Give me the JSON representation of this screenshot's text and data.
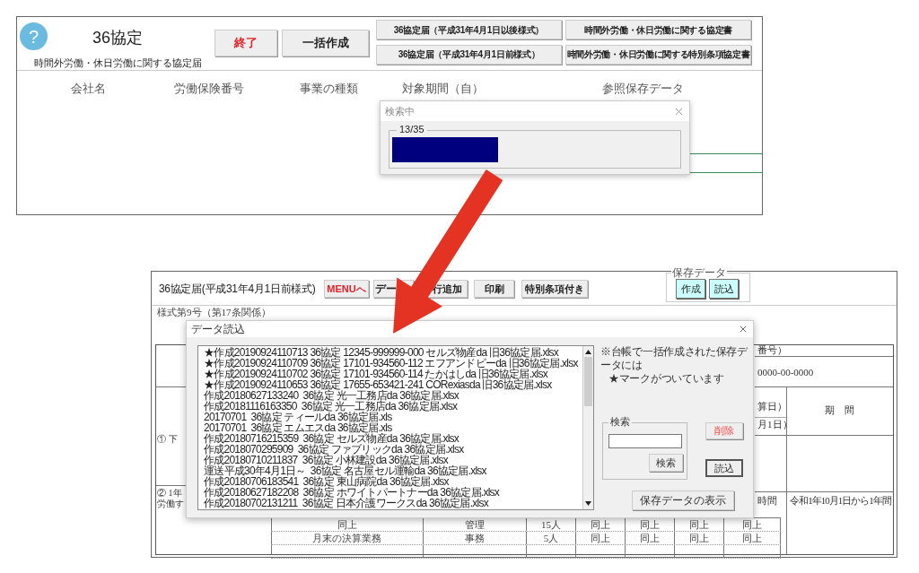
{
  "top_screen": {
    "help_badge": "?",
    "title": "36協定",
    "subtitle": "時間外労働・休日労働に関する協定届",
    "buttons": [
      {
        "label": "終了",
        "kind": "danger"
      },
      {
        "label": "一括作成",
        "kind": "normal"
      }
    ],
    "form_buttons": [
      "36協定届（平成31年4月1日以後様式）",
      "時間外労働・休日労働に関する協定書",
      "36協定届（平成31年4月1日前様式）",
      "時間外労働・休日労働に関する特別条項協定書"
    ],
    "columns": [
      "会社名",
      "労働保険番号",
      "事業の種類",
      "対象期間（自）",
      "参照保存データ"
    ],
    "progress_dialog": {
      "title": "検索中",
      "count": "13/35",
      "level": 0.37
    }
  },
  "bottom_screen": {
    "title": "36協定届(平成31年4月1日前様式)",
    "toolbar": [
      {
        "label": "MENUへ",
        "kind": "danger"
      },
      {
        "label": "デー",
        "kind": "normal"
      },
      {
        "label": "行追加",
        "kind": "normal"
      },
      {
        "label": "印刷",
        "kind": "normal"
      },
      {
        "label": "特別条項付き",
        "kind": "normal"
      }
    ],
    "saved_data": {
      "label": "保存データ",
      "buttons": [
        "作成",
        "読込"
      ]
    },
    "form": {
      "form_number": "様式第9号（第17条関係）",
      "number_header": "番号）",
      "insurance_number": "0000-00-0000",
      "date_labels": [
        "算日）",
        "月1日）"
      ],
      "period_header": "期　間",
      "section_1": "① 下",
      "section_2": [
        "② 1年",
        "労働す"
      ],
      "hours_header": "時間",
      "period": "令和1年10月1日から1年間",
      "rows": [
        [
          "同上",
          "管理",
          "15人",
          "同上",
          "同上",
          "同上",
          "同上"
        ],
        [
          "月末の決算業務",
          "事務",
          "5人",
          "同上",
          "同上",
          "同上",
          "同上"
        ]
      ]
    },
    "dialog": {
      "title": "データ読込",
      "files": [
        "★作成20190924110713 36協定 12345-999999-000 セルズ物産da 旧36協定届.xlsx",
        "★作成20190924110709 36協定 17101-934560-112 エフアンドビーda 旧36協定届.xlsx",
        "★作成20190924110702 36協定 17101-934560-114 たかはしda 旧36協定届.xlsx",
        "★作成20190924110653 36協定 17655-653421-241 CORexiasda 旧36協定届.xlsx",
        "作成20180627133240  36協定 光一工務店da 36協定届.xlsx",
        "作成20181116163350  36協定 光一工務店da 36協定届.xlsx",
        "20170701  36協定 ティールda 36協定届.xls",
        "20170701  36協定 エムエスda 36協定届.xls",
        "作成20180716215359  36協定 セルズ物産da 36協定届.xlsx",
        "作成2018070295909  36協定 ファブリックda 36協定届.xlsx",
        "作成20180710211837  36協定 小林建設da 36協定届.xlsx",
        "運送平成30年4月1日～  36協定 名古屋セル運輸da 36協定届.xlsx",
        "作成20180706183541  36協定 東山病院da 36協定届.xlsx",
        "作成20180627182208  36協定 ホワイトパートナーda 36協定届.xlsx",
        "作成20180702131211  36協定 日本介護ワークスda 36協定届.xlsx"
      ],
      "note": [
        "※台帳で一括作成された保存データには",
        "★マークがついています"
      ],
      "search": {
        "label": "検索",
        "button": "検索"
      },
      "delete_button": "削除",
      "load_button": "読込",
      "show_button": "保存データの表示"
    }
  }
}
